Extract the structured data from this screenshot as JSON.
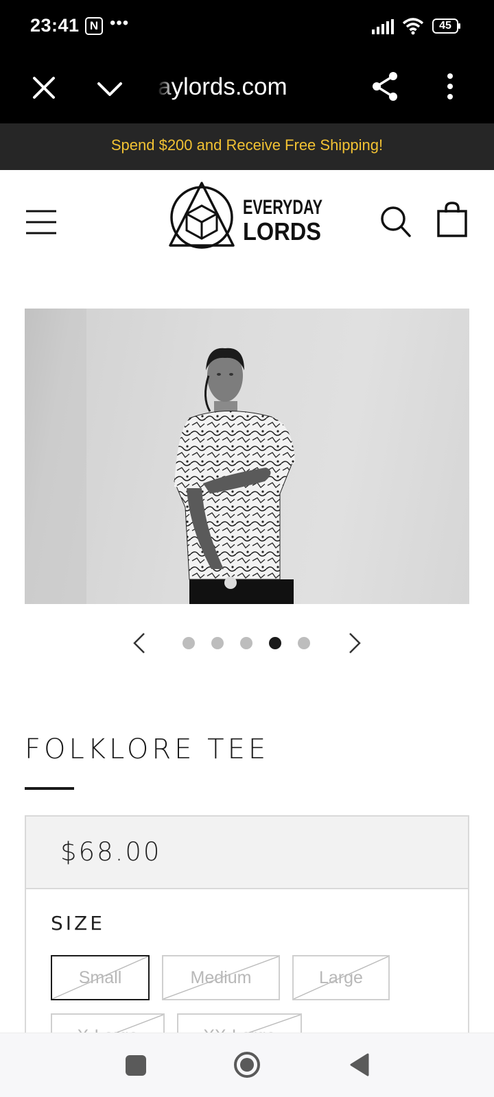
{
  "status_bar": {
    "time": "23:41",
    "notification_icon": "N",
    "overflow": "•••",
    "battery": "45"
  },
  "browser": {
    "url": "aylords.com",
    "icons": [
      "close-icon",
      "chevron-down-icon",
      "share-icon",
      "more-vert-icon"
    ]
  },
  "announcement": "Spend $200 and Receive Free Shipping!",
  "header": {
    "logo_line1": "EVERYDAY",
    "logo_line2": "LORDS",
    "icons": [
      "menu-icon",
      "search-icon",
      "cart-icon"
    ]
  },
  "carousel": {
    "slide_count": 5,
    "active_index": 3
  },
  "product": {
    "title": "FOLKLORE TEE",
    "price": "$68.00",
    "size_label": "SIZE",
    "sizes": [
      "Small",
      "Medium",
      "Large",
      "X-Large",
      "XX-Large"
    ],
    "selected_size": "Small",
    "all_sizes_unavailable": true
  },
  "colors": {
    "announcement_bg": "#262626",
    "announcement_text": "#f2c233",
    "browser_bg": "#000000",
    "price_bg": "#f2f2f2"
  }
}
